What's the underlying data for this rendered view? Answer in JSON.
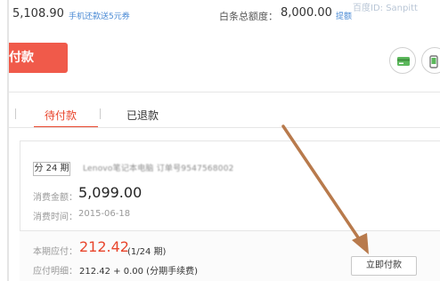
{
  "summary": {
    "balance": "5,108.90",
    "promo": "手机还款送5元券",
    "credit_label": "白条总额度：",
    "credit_value": "8,000.00",
    "raise_link": "提额",
    "watermark": "百度ID: Sanpitt"
  },
  "pay_button": "付款",
  "tabs": [
    {
      "label": "待付款",
      "active": true
    },
    {
      "label": "已退款",
      "active": false
    }
  ],
  "order": {
    "period_badge": "分 24 期",
    "product_name": "Lenovo笔记本电脑 订单号9547568002",
    "amount_label": "消费金额：",
    "amount_value": "5,099.00",
    "time_label": "消费时间：",
    "time_value": "2015-06-18"
  },
  "bill": {
    "due_label": "本期应付：",
    "due_value": "212.42",
    "due_period": "(1/24 期)",
    "detail_label": "应付明细：",
    "detail_value": "212.42 + 0.00 (分期手续费)",
    "pay_now": "立即付款"
  },
  "colors": {
    "accent_red": "#f05a4a",
    "link_blue": "#4a8ad4",
    "arrow_brown": "#b87a4c"
  },
  "icons": [
    "credit-card-icon",
    "phone-icon",
    "annotation-arrow-icon"
  ]
}
